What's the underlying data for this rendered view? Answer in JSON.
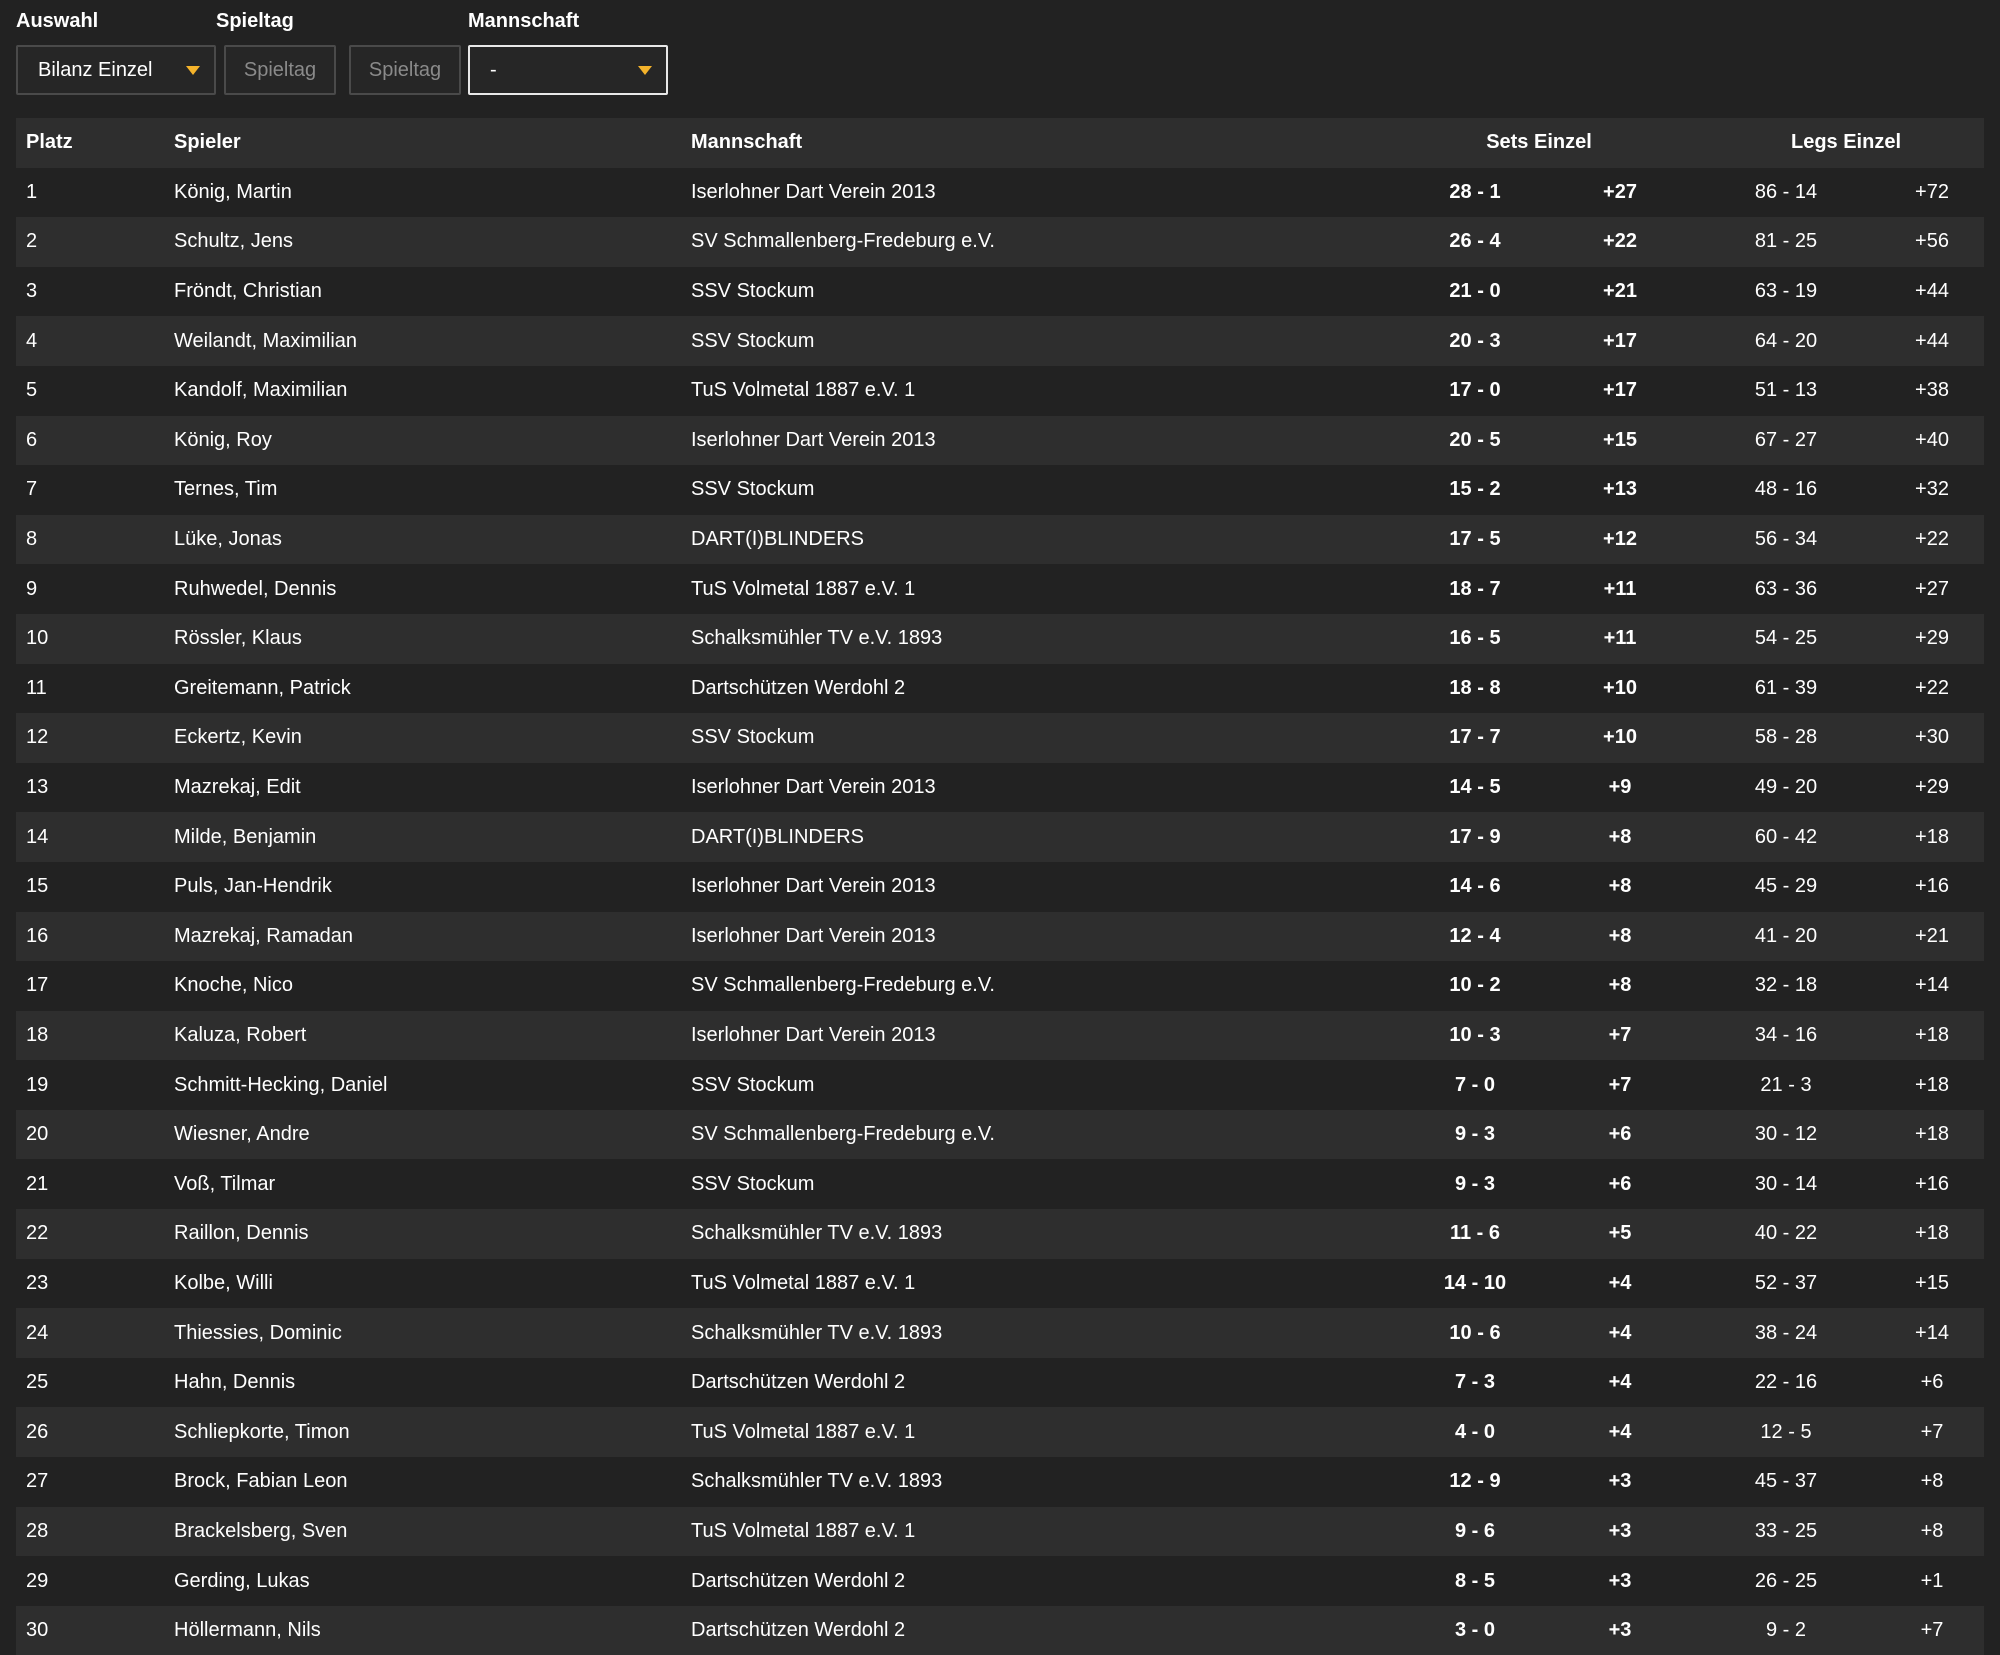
{
  "filters": {
    "auswahl_label": "Auswahl",
    "spieltag_label": "Spieltag",
    "mannschaft_label": "Mannschaft",
    "auswahl_value": "Bilanz Einzel",
    "spieltag_from_placeholder": "Spieltag",
    "spieltag_to_placeholder": "Spieltag",
    "mannschaft_value": "-"
  },
  "colors": {
    "background": "#222222",
    "row_alt": "#2e2e2e",
    "accent_caret": "#f4b32b"
  },
  "table": {
    "headers": {
      "platz": "Platz",
      "spieler": "Spieler",
      "mannschaft": "Mannschaft",
      "sets": "Sets Einzel",
      "legs": "Legs Einzel"
    },
    "rows": [
      {
        "platz": "1",
        "spieler": "König, Martin",
        "mannschaft": "Iserlohner Dart Verein 2013",
        "sets": "28 - 1",
        "sets_diff": "+27",
        "legs": "86 - 14",
        "legs_diff": "+72"
      },
      {
        "platz": "2",
        "spieler": "Schultz, Jens",
        "mannschaft": "SV Schmallenberg-Fredeburg e.V.",
        "sets": "26 - 4",
        "sets_diff": "+22",
        "legs": "81 - 25",
        "legs_diff": "+56"
      },
      {
        "platz": "3",
        "spieler": "Fröndt, Christian",
        "mannschaft": "SSV Stockum",
        "sets": "21 - 0",
        "sets_diff": "+21",
        "legs": "63 - 19",
        "legs_diff": "+44"
      },
      {
        "platz": "4",
        "spieler": "Weilandt, Maximilian",
        "mannschaft": "SSV Stockum",
        "sets": "20 - 3",
        "sets_diff": "+17",
        "legs": "64 - 20",
        "legs_diff": "+44"
      },
      {
        "platz": "5",
        "spieler": "Kandolf, Maximilian",
        "mannschaft": "TuS Volmetal 1887 e.V. 1",
        "sets": "17 - 0",
        "sets_diff": "+17",
        "legs": "51 - 13",
        "legs_diff": "+38"
      },
      {
        "platz": "6",
        "spieler": "König, Roy",
        "mannschaft": "Iserlohner Dart Verein 2013",
        "sets": "20 - 5",
        "sets_diff": "+15",
        "legs": "67 - 27",
        "legs_diff": "+40"
      },
      {
        "platz": "7",
        "spieler": "Ternes, Tim",
        "mannschaft": "SSV Stockum",
        "sets": "15 - 2",
        "sets_diff": "+13",
        "legs": "48 - 16",
        "legs_diff": "+32"
      },
      {
        "platz": "8",
        "spieler": "Lüke, Jonas",
        "mannschaft": "DART(I)BLINDERS",
        "sets": "17 - 5",
        "sets_diff": "+12",
        "legs": "56 - 34",
        "legs_diff": "+22"
      },
      {
        "platz": "9",
        "spieler": "Ruhwedel, Dennis",
        "mannschaft": "TuS Volmetal 1887 e.V. 1",
        "sets": "18 - 7",
        "sets_diff": "+11",
        "legs": "63 - 36",
        "legs_diff": "+27"
      },
      {
        "platz": "10",
        "spieler": "Rössler, Klaus",
        "mannschaft": "Schalksmühler TV e.V. 1893",
        "sets": "16 - 5",
        "sets_diff": "+11",
        "legs": "54 - 25",
        "legs_diff": "+29"
      },
      {
        "platz": "11",
        "spieler": "Greitemann, Patrick",
        "mannschaft": "Dartschützen Werdohl 2",
        "sets": "18 - 8",
        "sets_diff": "+10",
        "legs": "61 - 39",
        "legs_diff": "+22"
      },
      {
        "platz": "12",
        "spieler": "Eckertz, Kevin",
        "mannschaft": "SSV Stockum",
        "sets": "17 - 7",
        "sets_diff": "+10",
        "legs": "58 - 28",
        "legs_diff": "+30"
      },
      {
        "platz": "13",
        "spieler": "Mazrekaj, Edit",
        "mannschaft": "Iserlohner Dart Verein 2013",
        "sets": "14 - 5",
        "sets_diff": "+9",
        "legs": "49 - 20",
        "legs_diff": "+29"
      },
      {
        "platz": "14",
        "spieler": "Milde, Benjamin",
        "mannschaft": "DART(I)BLINDERS",
        "sets": "17 - 9",
        "sets_diff": "+8",
        "legs": "60 - 42",
        "legs_diff": "+18"
      },
      {
        "platz": "15",
        "spieler": "Puls, Jan-Hendrik",
        "mannschaft": "Iserlohner Dart Verein 2013",
        "sets": "14 - 6",
        "sets_diff": "+8",
        "legs": "45 - 29",
        "legs_diff": "+16"
      },
      {
        "platz": "16",
        "spieler": "Mazrekaj, Ramadan",
        "mannschaft": "Iserlohner Dart Verein 2013",
        "sets": "12 - 4",
        "sets_diff": "+8",
        "legs": "41 - 20",
        "legs_diff": "+21"
      },
      {
        "platz": "17",
        "spieler": "Knoche, Nico",
        "mannschaft": "SV Schmallenberg-Fredeburg e.V.",
        "sets": "10 - 2",
        "sets_diff": "+8",
        "legs": "32 - 18",
        "legs_diff": "+14"
      },
      {
        "platz": "18",
        "spieler": "Kaluza, Robert",
        "mannschaft": "Iserlohner Dart Verein 2013",
        "sets": "10 - 3",
        "sets_diff": "+7",
        "legs": "34 - 16",
        "legs_diff": "+18"
      },
      {
        "platz": "19",
        "spieler": "Schmitt-Hecking, Daniel",
        "mannschaft": "SSV Stockum",
        "sets": "7 - 0",
        "sets_diff": "+7",
        "legs": "21 - 3",
        "legs_diff": "+18"
      },
      {
        "platz": "20",
        "spieler": "Wiesner, Andre",
        "mannschaft": "SV Schmallenberg-Fredeburg e.V.",
        "sets": "9 - 3",
        "sets_diff": "+6",
        "legs": "30 - 12",
        "legs_diff": "+18"
      },
      {
        "platz": "21",
        "spieler": "Voß, Tilmar",
        "mannschaft": "SSV Stockum",
        "sets": "9 - 3",
        "sets_diff": "+6",
        "legs": "30 - 14",
        "legs_diff": "+16"
      },
      {
        "platz": "22",
        "spieler": "Raillon, Dennis",
        "mannschaft": "Schalksmühler TV e.V. 1893",
        "sets": "11 - 6",
        "sets_diff": "+5",
        "legs": "40 - 22",
        "legs_diff": "+18"
      },
      {
        "platz": "23",
        "spieler": "Kolbe, Willi",
        "mannschaft": "TuS Volmetal 1887 e.V. 1",
        "sets": "14 - 10",
        "sets_diff": "+4",
        "legs": "52 - 37",
        "legs_diff": "+15"
      },
      {
        "platz": "24",
        "spieler": "Thiessies, Dominic",
        "mannschaft": "Schalksmühler TV e.V. 1893",
        "sets": "10 - 6",
        "sets_diff": "+4",
        "legs": "38 - 24",
        "legs_diff": "+14"
      },
      {
        "platz": "25",
        "spieler": "Hahn, Dennis",
        "mannschaft": "Dartschützen Werdohl 2",
        "sets": "7 - 3",
        "sets_diff": "+4",
        "legs": "22 - 16",
        "legs_diff": "+6"
      },
      {
        "platz": "26",
        "spieler": "Schliepkorte, Timon",
        "mannschaft": "TuS Volmetal 1887 e.V. 1",
        "sets": "4 - 0",
        "sets_diff": "+4",
        "legs": "12 - 5",
        "legs_diff": "+7"
      },
      {
        "platz": "27",
        "spieler": "Brock, Fabian Leon",
        "mannschaft": "Schalksmühler TV e.V. 1893",
        "sets": "12 - 9",
        "sets_diff": "+3",
        "legs": "45 - 37",
        "legs_diff": "+8"
      },
      {
        "platz": "28",
        "spieler": "Brackelsberg, Sven",
        "mannschaft": "TuS Volmetal 1887 e.V. 1",
        "sets": "9 - 6",
        "sets_diff": "+3",
        "legs": "33 - 25",
        "legs_diff": "+8"
      },
      {
        "platz": "29",
        "spieler": "Gerding, Lukas",
        "mannschaft": "Dartschützen Werdohl 2",
        "sets": "8 - 5",
        "sets_diff": "+3",
        "legs": "26 - 25",
        "legs_diff": "+1"
      },
      {
        "platz": "30",
        "spieler": "Höllermann, Nils",
        "mannschaft": "Dartschützen Werdohl 2",
        "sets": "3 - 0",
        "sets_diff": "+3",
        "legs": "9 - 2",
        "legs_diff": "+7"
      }
    ]
  }
}
